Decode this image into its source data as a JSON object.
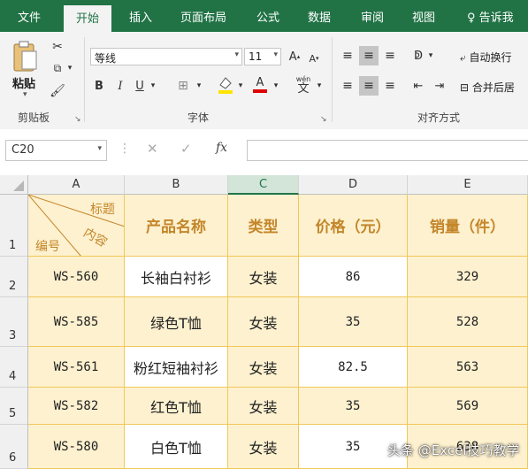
{
  "tabs": [
    "文件",
    "开始",
    "插入",
    "页面布局",
    "公式",
    "数据",
    "审阅",
    "视图"
  ],
  "active_tab": "开始",
  "tell_me": "告诉我",
  "ribbon": {
    "paste_label": "粘贴",
    "clipboard_group": "剪贴板",
    "font_group": "字体",
    "align_group": "对齐方式",
    "font_name": "等线",
    "font_size": "11",
    "bold": "B",
    "italic": "I",
    "underline": "U",
    "wrap_text": "自动换行",
    "merge_center": "合并后居",
    "wen_label": "wén",
    "wen_char": "文"
  },
  "formula_bar": {
    "name_box": "C20",
    "fx": "fx",
    "formula": ""
  },
  "columns": [
    "A",
    "B",
    "C",
    "D",
    "E"
  ],
  "selected_column": "C",
  "rows": [
    "1",
    "2",
    "3",
    "4",
    "5",
    "6"
  ],
  "header_cell": {
    "top": "标题",
    "middle": "内容",
    "bottom": "编号"
  },
  "headers": [
    "产品名称",
    "类型",
    "价格（元）",
    "销量（件）"
  ],
  "data": [
    {
      "id": "WS-560",
      "name": "长袖白衬衫",
      "type": "女装",
      "price": "86",
      "sales": "329"
    },
    {
      "id": "WS-585",
      "name": "绿色T恤",
      "type": "女装",
      "price": "35",
      "sales": "528"
    },
    {
      "id": "WS-561",
      "name": "粉红短袖衬衫",
      "type": "女装",
      "price": "82.5",
      "sales": "563"
    },
    {
      "id": "WS-582",
      "name": "红色T恤",
      "type": "女装",
      "price": "35",
      "sales": "569"
    },
    {
      "id": "WS-580",
      "name": "白色T恤",
      "type": "女装",
      "price": "35",
      "sales": "638"
    }
  ],
  "watermark": "头条 @Excel技巧教学",
  "colors": {
    "accent": "#217346",
    "cell_fill": "#fdf1cf",
    "header_text": "#c4862a",
    "border": "#f0c85a"
  }
}
